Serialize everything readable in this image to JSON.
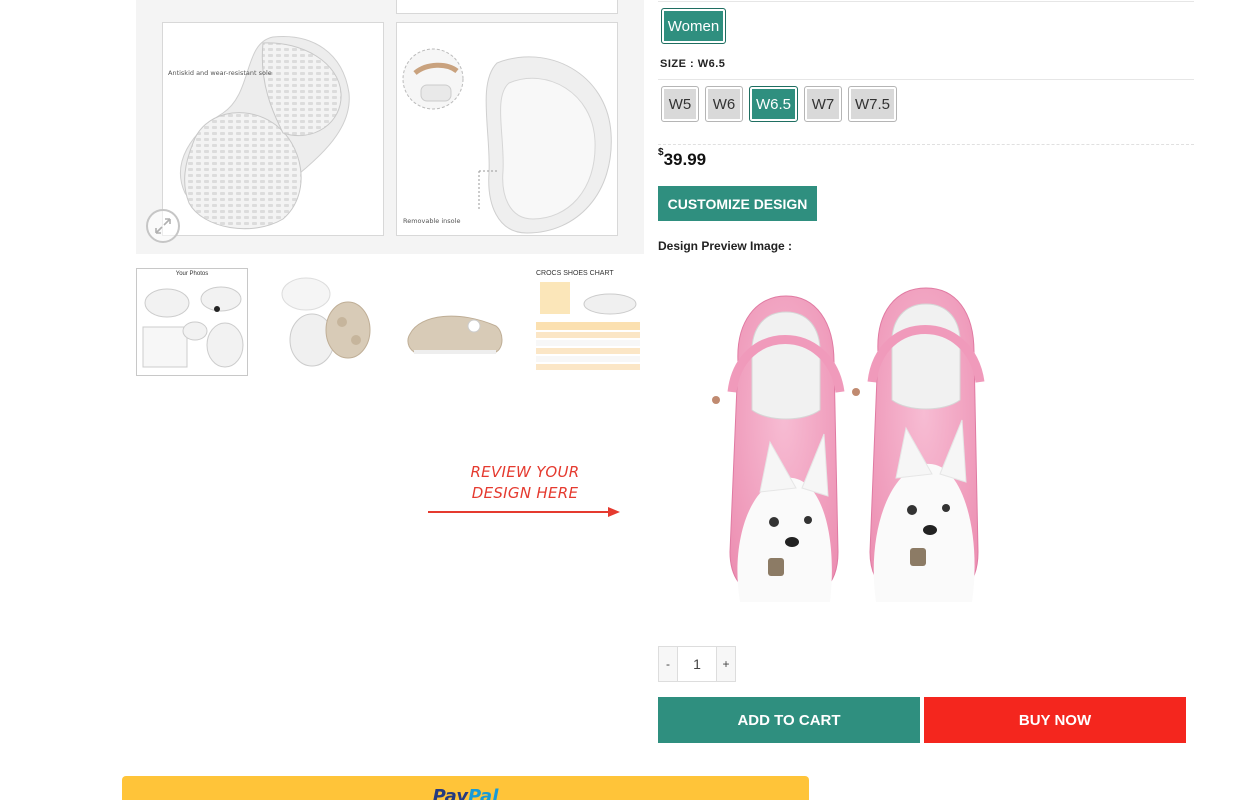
{
  "gallery": {
    "main_image": {
      "sole_caption": "Antiskid and wear-resistant sole",
      "insole_caption": "Removable insole"
    },
    "thumbnails": [
      {
        "caption": "Your Photos",
        "active": true
      },
      {
        "caption": "",
        "active": false
      },
      {
        "caption": "",
        "active": false
      },
      {
        "caption": "CROCS SHOES CHART",
        "active": false
      }
    ]
  },
  "callout": {
    "line1": "REVIEW YOUR",
    "line2": "DESIGN HERE",
    "color": "#e53a2f"
  },
  "product": {
    "gender_option": "Women",
    "size": {
      "label": "SIZE",
      "selected": "W6.5",
      "options": [
        "W5",
        "W6",
        "W6.5",
        "W7",
        "W7.5"
      ]
    },
    "price": {
      "currency": "$",
      "amount": "39.99"
    },
    "customize_label": "CUSTOMIZE DESIGN",
    "preview_label": "Design Preview Image :",
    "quantity": {
      "minus": "-",
      "value": "1",
      "plus": "+"
    },
    "add_to_cart_label": "ADD TO CART",
    "buy_now_label": "BUY NOW"
  },
  "paypal": {
    "part1": "Pay",
    "part2": "Pal"
  },
  "colors": {
    "accent": "#2f8f7f",
    "buy_now": "#f4261e",
    "paypal": "#ffc439",
    "clog_pink": "#f2a3c0"
  },
  "icons": {
    "zoom": "zoom-out-icon",
    "arrow": "right-arrow-icon"
  }
}
